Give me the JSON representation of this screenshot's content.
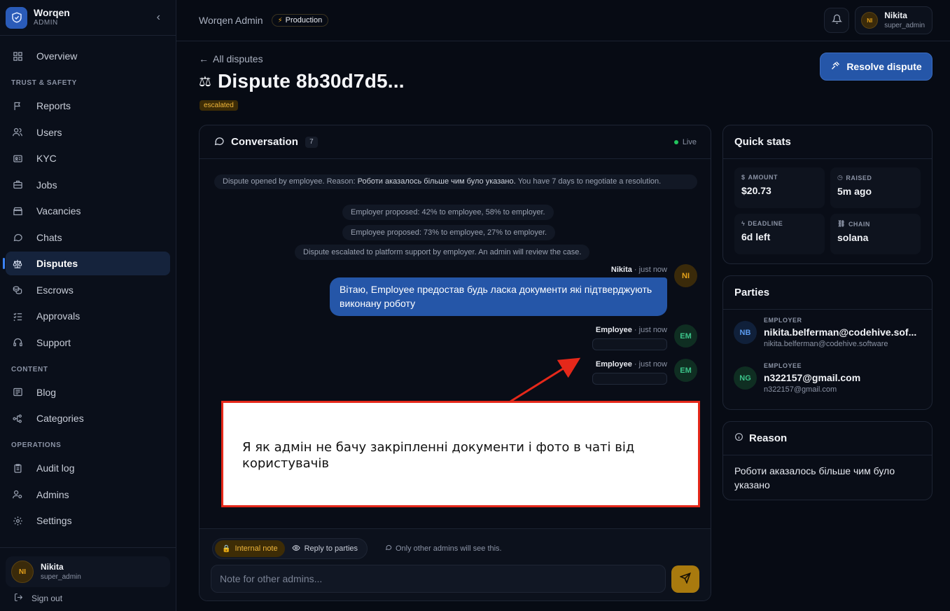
{
  "brand": {
    "name": "Worqen",
    "sub": "ADMIN"
  },
  "nav": {
    "items_top": [
      {
        "label": "Overview",
        "icon": "grid-icon"
      }
    ],
    "section_trust": "TRUST & SAFETY",
    "items_trust": [
      {
        "label": "Reports",
        "icon": "flag-icon"
      },
      {
        "label": "Users",
        "icon": "users-icon"
      },
      {
        "label": "KYC",
        "icon": "id-card-icon"
      },
      {
        "label": "Jobs",
        "icon": "briefcase-icon"
      },
      {
        "label": "Vacancies",
        "icon": "store-icon"
      },
      {
        "label": "Chats",
        "icon": "chat-icon"
      },
      {
        "label": "Disputes",
        "icon": "scale-icon",
        "active": true
      },
      {
        "label": "Escrows",
        "icon": "coins-icon"
      },
      {
        "label": "Approvals",
        "icon": "checklist-icon"
      },
      {
        "label": "Support",
        "icon": "headset-icon"
      }
    ],
    "section_content": "CONTENT",
    "items_content": [
      {
        "label": "Blog",
        "icon": "newspaper-icon"
      },
      {
        "label": "Categories",
        "icon": "network-icon"
      }
    ],
    "section_operations": "OPERATIONS",
    "items_operations": [
      {
        "label": "Audit log",
        "icon": "clipboard-icon"
      },
      {
        "label": "Admins",
        "icon": "user-cog-icon"
      },
      {
        "label": "Settings",
        "icon": "gear-icon"
      }
    ]
  },
  "sidebar_user": {
    "initials": "NI",
    "name": "Nikita",
    "role": "super_admin",
    "signout": "Sign out"
  },
  "topbar": {
    "app_title": "Worqen Admin",
    "env": "Production",
    "user_initials": "NI",
    "user_name": "Nikita",
    "user_role": "super_admin"
  },
  "header": {
    "back": "All disputes",
    "title": "Dispute 8b30d7d5...",
    "status": "escalated",
    "resolve_label": "Resolve dispute"
  },
  "conversation": {
    "title": "Conversation",
    "count": "7",
    "live": "Live",
    "system": {
      "opened_prefix": "Dispute opened by employee. Reason: ",
      "opened_reason": "Роботи аказалось більше чим було указано.",
      "opened_suffix": " You have 7 days to negotiate a resolution.",
      "employer_proposed": "Employer proposed: 42% to employee, 58% to employer.",
      "employee_proposed": "Employee proposed: 73% to employee, 27% to employer.",
      "escalated": "Dispute escalated to platform support by employer. An admin will review the case."
    },
    "admin_msg": {
      "author": "Nikita",
      "time": "· just now",
      "initials": "NI",
      "text": "Вітаю, Employee предостав будь ласка документи які підтверджують виконану роботу"
    },
    "employee_msg_1": {
      "author": "Employee",
      "time": "· just now",
      "initials": "EM"
    },
    "employee_msg_2": {
      "author": "Employee",
      "time": "· just now",
      "initials": "EM"
    },
    "annotation": "Я як адмін не бачу закріпленні документи і фото в чаті від користувачів"
  },
  "composer": {
    "internal_note": "Internal note",
    "reply_parties": "Reply to parties",
    "hint": "Only other admins will see this.",
    "placeholder": "Note for other admins..."
  },
  "quick_stats": {
    "title": "Quick stats",
    "amount_label": "AMOUNT",
    "amount": "$20.73",
    "raised_label": "RAISED",
    "raised": "5m ago",
    "deadline_label": "DEADLINE",
    "deadline": "6d left",
    "chain_label": "CHAIN",
    "chain": "solana"
  },
  "parties": {
    "title": "Parties",
    "employer": {
      "role": "EMPLOYER",
      "initials": "NB",
      "name": "nikita.belferman@codehive.sof...",
      "email": "nikita.belferman@codehive.software"
    },
    "employee": {
      "role": "EMPLOYEE",
      "initials": "NG",
      "name": "n322157@gmail.com",
      "email": "n322157@gmail.com"
    }
  },
  "reason": {
    "title": "Reason",
    "text": "Роботи аказалось більше чим було указано"
  }
}
